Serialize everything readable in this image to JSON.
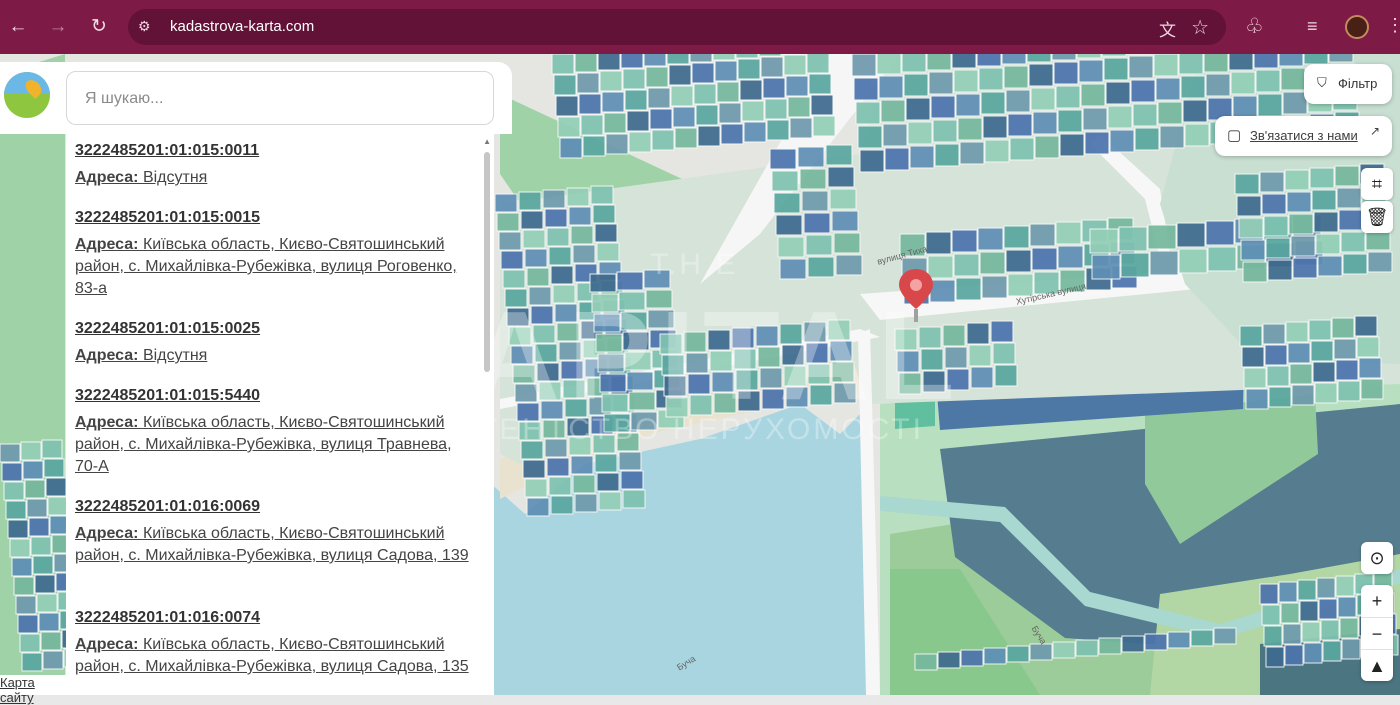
{
  "browser": {
    "url": "kadastrova-karta.com",
    "theme_color": "#7d1a45"
  },
  "search": {
    "placeholder": "Я шукаю..."
  },
  "results": [
    {
      "cadastral_number": "3222485201:01:015:0011",
      "address_label": "Адреса:",
      "address": "Відсутня"
    },
    {
      "cadastral_number": "3222485201:01:015:0015",
      "address_label": "Адреса:",
      "address": "Київська область, Києво-Святошинський район, с. Михайлівка-Рубежівка, вулиця Роговенко, 83-а"
    },
    {
      "cadastral_number": "3222485201:01:015:0025",
      "address_label": "Адреса:",
      "address": "Відсутня"
    },
    {
      "cadastral_number": "3222485201:01:015:5440",
      "address_label": "Адреса:",
      "address": "Київська область, Києво-Святошинський район, с. Михайлівка-Рубежівка, вулиця Травнева, 70-А"
    },
    {
      "cadastral_number": "3222485201:01:016:0069",
      "address_label": "Адреса:",
      "address": "Київська область, Києво-Святошинський район, с. Михайлівка-Рубежівка, вулиця Садова, 139"
    },
    {
      "cadastral_number": "3222485201:01:016:0074",
      "address_label": "Адреса:",
      "address": "Київська область, Києво-Святошинський район, с. Михайлівка-Рубежівка, вулиця Садова, 135"
    }
  ],
  "map": {
    "filter_label": "Фільтр",
    "contact_label": "Зв'язатися з нами",
    "sitemap_label": "Карта сайту",
    "street_labels": [
      "Хутірська вулиця",
      "вулиця Тиха",
      "Буча",
      "Буча"
    ],
    "watermark_top": "T.H.E",
    "watermark_main": "CAPITAL",
    "watermark_sub": "АГЕНТСТВО НЕРУХОМОСТІ"
  },
  "icons": {
    "back": "arrow-left-icon",
    "forward": "arrow-right-icon",
    "reload": "reload-icon",
    "site_settings": "site-settings-icon",
    "translate": "translate-icon",
    "bookmark": "star-icon",
    "extensions": "puzzle-icon",
    "media": "media-queue-icon",
    "profile": "avatar",
    "filter": "filter-icon",
    "chat": "chat-icon",
    "external": "external-link-icon",
    "measure": "square-measure-icon",
    "delete": "trash-icon",
    "locate": "location-icon",
    "zoom_in": "plus-icon",
    "zoom_out": "minus-icon",
    "compass": "compass-icon",
    "pin": "map-pin-icon"
  }
}
